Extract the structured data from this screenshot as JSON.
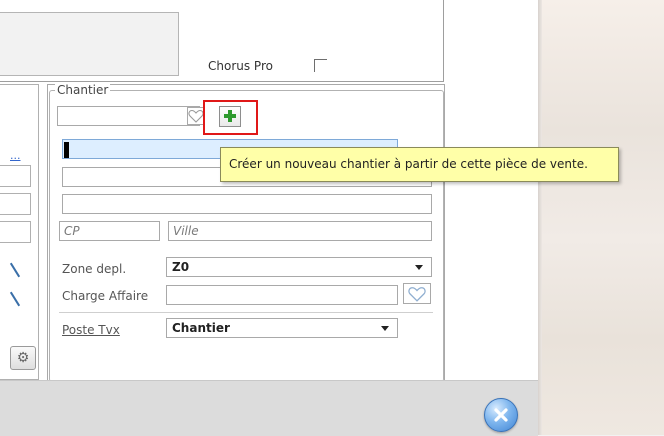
{
  "top": {
    "chorus_label": "Chorus Pro"
  },
  "left": {
    "link_text": "..."
  },
  "chantier": {
    "title": "Chantier",
    "cp_placeholder": "CP",
    "ville_placeholder": "Ville",
    "zone_label": "Zone depl.",
    "zone_value": "Z0",
    "charge_label": "Charge Affaire",
    "poste_label": "Poste Tvx",
    "poste_value": "Chantier"
  },
  "tooltip": {
    "text": "Créer un nouveau chantier à partir de cette pièce de vente."
  },
  "colors": {
    "highlight": "#e01818",
    "tooltip_bg": "#ffffa8",
    "plus_green": "#2e9a2e"
  },
  "icons": [
    "heart-icon",
    "plus-icon",
    "gear-icon",
    "close-icon",
    "chevron-down-icon"
  ]
}
